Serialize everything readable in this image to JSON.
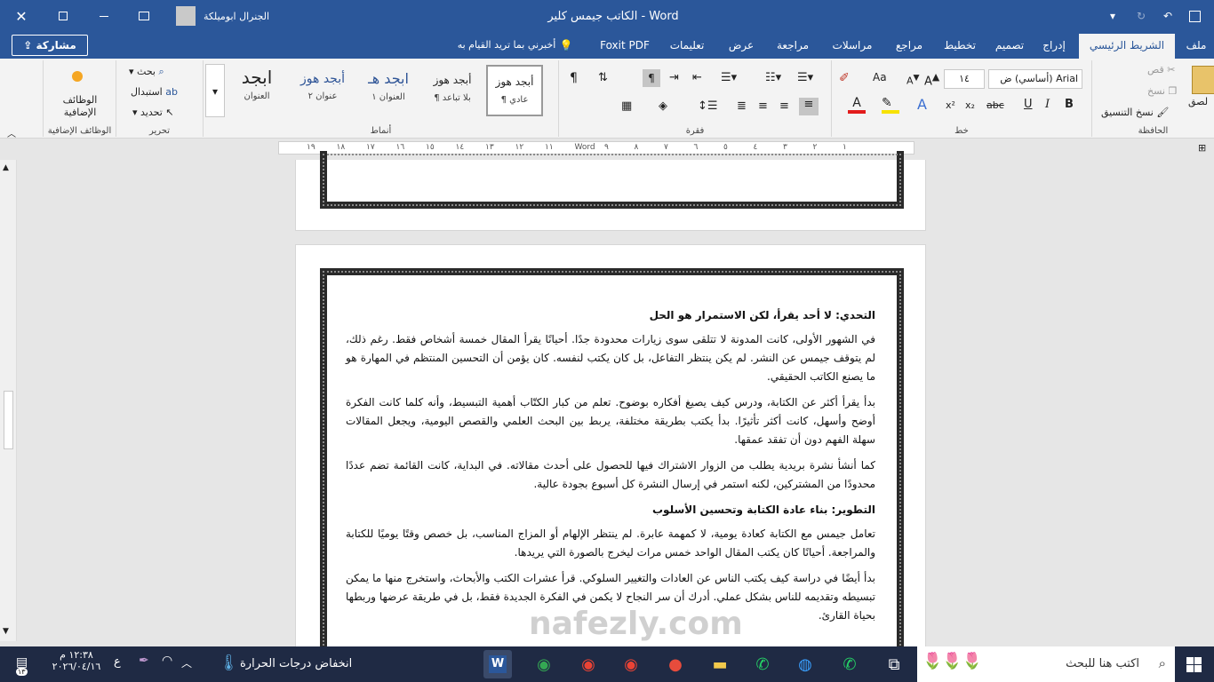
{
  "window": {
    "title": "الكاتب جيمس كلير  -  Word",
    "user": "الجنرال ابوميلكة",
    "share_label": "مشاركة"
  },
  "tabs": [
    "ملف",
    "الشريط الرئيسي",
    "إدراج",
    "تصميم",
    "تخطيط",
    "مراجع",
    "مراسلات",
    "مراجعة",
    "عرض",
    "تعليمات",
    "Foxit PDF"
  ],
  "tell_me": "أخبرني بما تريد القيام به",
  "ribbon": {
    "clipboard": {
      "label": "الحافظة",
      "paste": "لصق",
      "cut": "قص",
      "copy": "نسخ",
      "format_painter": "نسخ التنسيق"
    },
    "font": {
      "label": "خط",
      "name": "Arial (أساسي) ض",
      "size": "١٤",
      "bold": "B",
      "italic": "I",
      "underline": "U",
      "strike": "abc",
      "sub": "x₂",
      "sup": "x²",
      "aa": "Aa"
    },
    "paragraph": {
      "label": "فقرة"
    },
    "styles": {
      "label": "أنماط",
      "items": [
        {
          "preview": "أبجد هوز",
          "name": "¶ عادي"
        },
        {
          "preview": "أبجد هوز",
          "name": "¶ بلا تباعد"
        },
        {
          "preview": "ابجد هـ",
          "name": "العنوان ١"
        },
        {
          "preview": "أبجد هوز",
          "name": "عنوان ٢"
        },
        {
          "preview": "ابجد",
          "name": "العنوان"
        }
      ]
    },
    "editing": {
      "label": "تحرير",
      "find": "بحث",
      "replace": "استبدال",
      "select": "تحديد"
    },
    "addins": {
      "label": "الوظائف الإضافية",
      "button": "الوظائف الإضافية"
    }
  },
  "ruler": {
    "marks": [
      "١",
      "٢",
      "٣",
      "٤",
      "٥",
      "٦",
      "٧",
      "٨",
      "٩",
      "Word",
      "١١",
      "١٢",
      "١٣",
      "١٤",
      "١٥",
      "١٦",
      "١٧",
      "١٨",
      "١٩"
    ]
  },
  "document": {
    "h1": "التحدي: لا أحد يقرأ، لكن الاستمرار هو الحل",
    "p1": "في الشهور الأولى، كانت المدونة لا تتلقى سوى زيارات محدودة جدًا. أحيانًا يقرأ المقال خمسة أشخاص فقط. رغم ذلك، لم يتوقف جيمس عن النشر. لم يكن ينتظر التفاعل، بل كان يكتب لنفسه. كان يؤمن أن التحسين المنتظم في المهارة هو ما يصنع الكاتب الحقيقي.",
    "p2": "بدأ يقرأ أكثر عن الكتابة، ودرس كيف يصيغ أفكاره بوضوح. تعلم من كبار الكتّاب أهمية التبسيط، وأنه كلما كانت الفكرة أوضح وأسهل، كانت أكثر تأثيرًا. بدأ يكتب بطريقة مختلفة، يربط بين البحث العلمي والقصص اليومية، ويجعل المقالات سهلة الفهم دون أن تفقد عمقها.",
    "p3": "كما أنشأ نشرة بريدية يطلب من الزوار الاشتراك فيها للحصول على أحدث مقالاته. في البداية، كانت القائمة تضم عددًا محدودًا من المشتركين، لكنه استمر في إرسال النشرة كل أسبوع بجودة عالية.",
    "h2": "التطوير: بناء عادة الكتابة وتحسين الأسلوب",
    "p4": "تعامل جيمس مع الكتابة كعادة يومية، لا كمهمة عابرة. لم ينتظر الإلهام أو المزاج المناسب، بل خصص وقتًا يوميًا للكتابة والمراجعة. أحيانًا كان يكتب المقال الواحد خمس مرات ليخرج بالصورة التي يريدها.",
    "p5": "بدأ أيضًا في دراسة كيف يكتب الناس عن العادات والتغيير السلوكي. قرأ عشرات الكتب والأبحاث، واستخرج منها ما يمكن تبسيطه وتقديمه للناس بشكل عملي. أدرك أن سر النجاح لا يكمن في الفكرة الجديدة فقط، بل في طريقة عرضها وربطها بحياة القارئ."
  },
  "taskbar": {
    "search": "اكتب هنا للبحث",
    "weather": "انخفاض درجات الحرارة",
    "time": "١٢:٣٨ م",
    "date": "٢٠٢٦/٠٤/١٦",
    "lang": "ع",
    "notif": "١٣"
  },
  "watermark": "nafezly.com"
}
